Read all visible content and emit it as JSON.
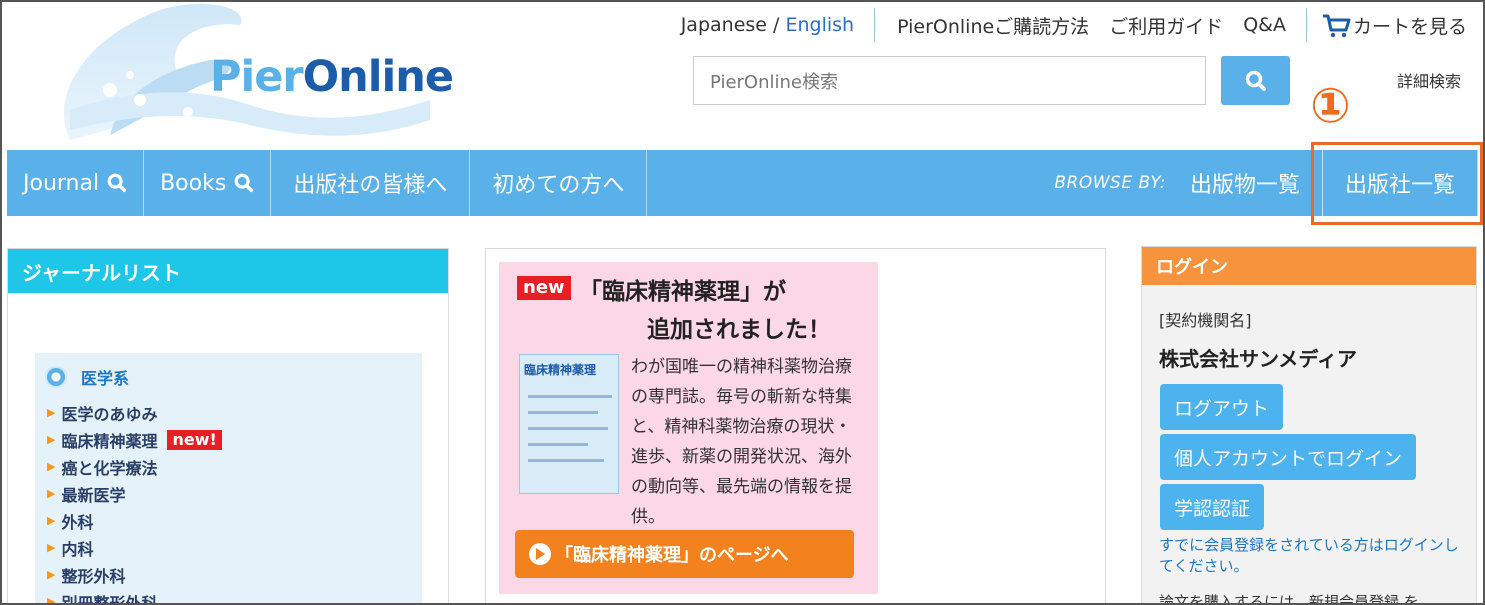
{
  "header": {
    "logo": {
      "part1": "Pier",
      "part2": "Online"
    },
    "topnav": {
      "japanese": "Japanese",
      "slash": " / ",
      "english": "English",
      "subscribe": "PierOnlineご購読方法",
      "guide": "ご利用ガイド",
      "qa": "Q&A",
      "cart": "カートを見る"
    },
    "search": {
      "placeholder": "PierOnline検索"
    },
    "advanced_search": "詳細検索"
  },
  "annotation": {
    "marker": "①",
    "color": "#ee6c1c"
  },
  "mainnav": {
    "journal": "Journal",
    "books": "Books",
    "publishers_info": "出版社の皆様へ",
    "first_time": "初めての方へ",
    "browse_by": "BROWSE BY:",
    "publications": "出版物一覧",
    "publishers": "出版社一覧"
  },
  "journal_list": {
    "title": "ジャーナルリスト",
    "category": "医学系",
    "items": [
      {
        "label": "医学のあゆみ",
        "new": ""
      },
      {
        "label": "臨床精神薬理",
        "new": "new!"
      },
      {
        "label": "癌と化学療法",
        "new": ""
      },
      {
        "label": "最新医学",
        "new": ""
      },
      {
        "label": "外科",
        "new": ""
      },
      {
        "label": "内科",
        "new": ""
      },
      {
        "label": "整形外科",
        "new": ""
      },
      {
        "label": "別冊整形外科",
        "new": ""
      }
    ]
  },
  "banner": {
    "new_tag": "new",
    "title_line1": "「臨床精神薬理」が",
    "title_line2": "追加されました！",
    "cover_title": "臨床精神薬理",
    "description": "わが国唯一の精神科薬物治療の専門誌。毎号の斬新な特集と、精神科薬物治療の現状・進歩、新薬の開発状況、海外の動向等、最先端の情報を提供。",
    "button": "「臨床精神薬理」のページへ"
  },
  "login": {
    "title": "ログイン",
    "institution_label": "[契約機関名]",
    "institution_name": "株式会社サンメディア",
    "logout": "ログアウト",
    "personal_login": "個人アカウントでログイン",
    "gakunin": "学認認証",
    "note": "すでに会員登録をされている方はログインしてください。",
    "note2": "論文を購入するには、新規会員登録 を"
  },
  "colors": {
    "nav_blue": "#5ab1ea",
    "journal_head": "#1ec6e8",
    "login_head": "#f7933c",
    "highlight": "#ec6a28",
    "banner_bg": "#fcd8e6"
  }
}
